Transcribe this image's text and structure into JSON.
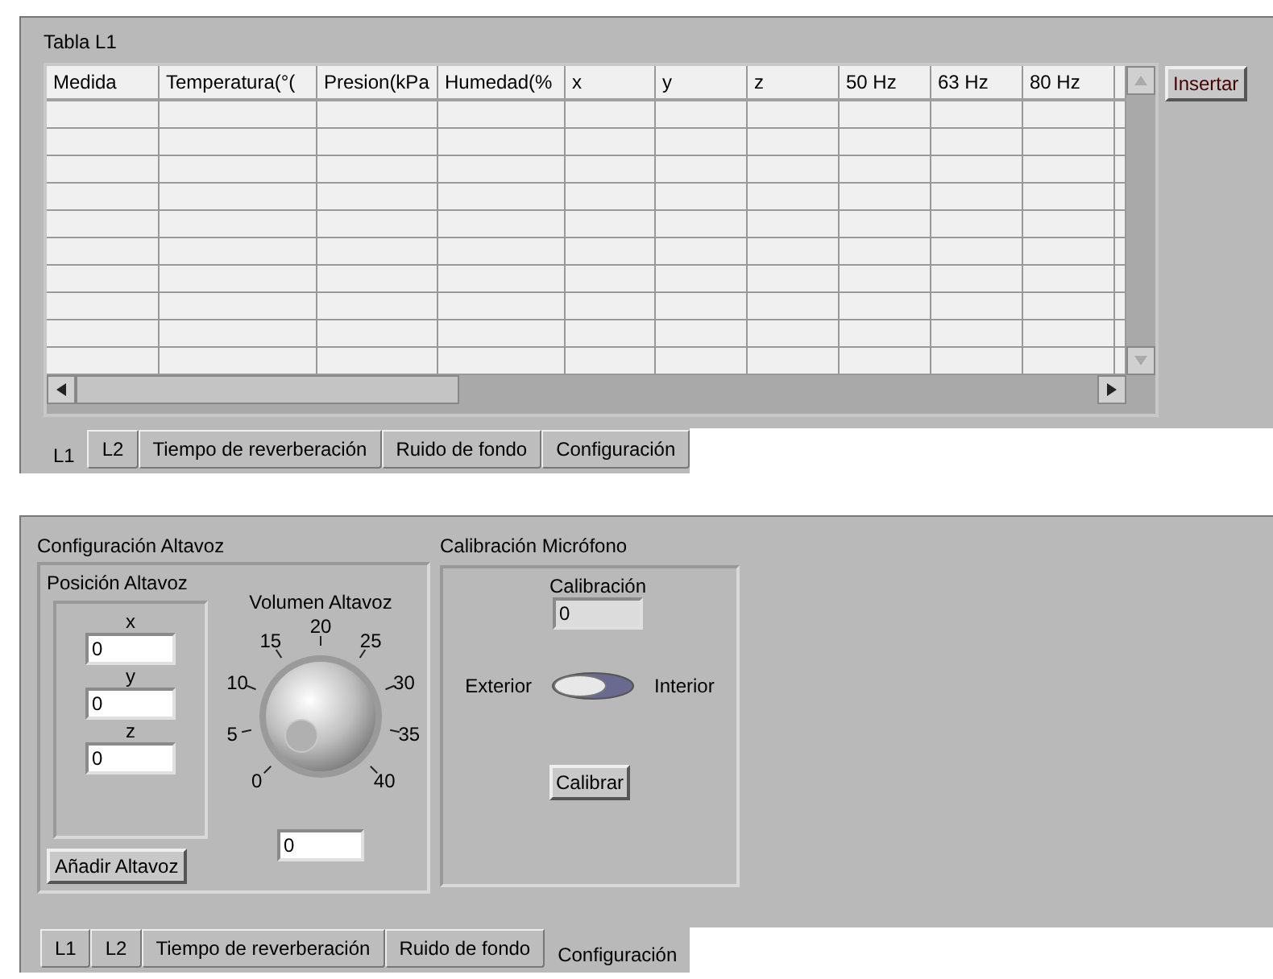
{
  "top_panel": {
    "table_label": "Tabla L1",
    "table": {
      "columns": [
        "Medida",
        "Temperatura(°(",
        "Presion(kPa",
        "Humedad(%",
        "x",
        "y",
        "z",
        "50 Hz",
        "63 Hz",
        "80 Hz"
      ]
    },
    "insert_button": "Insertar",
    "tabs": [
      {
        "label": "L1",
        "selected": true
      },
      {
        "label": "L2",
        "selected": false
      },
      {
        "label": "Tiempo de reverberación",
        "selected": false
      },
      {
        "label": "Ruido de fondo",
        "selected": false
      },
      {
        "label": "Configuración",
        "selected": false
      }
    ]
  },
  "bottom_panel": {
    "speaker_group": {
      "title": "Configuración Altavoz",
      "position": {
        "title": "Posición Altavoz",
        "fields": [
          {
            "label": "x",
            "value": "0"
          },
          {
            "label": "y",
            "value": "0"
          },
          {
            "label": "z",
            "value": "0"
          }
        ],
        "button": "Añadir Altavoz"
      },
      "volume": {
        "title": "Volumen Altavoz",
        "dial_labels": [
          "0",
          "5",
          "10",
          "15",
          "20",
          "25",
          "30",
          "35",
          "40"
        ],
        "value": "0"
      }
    },
    "calibration_group": {
      "title": "Calibración Micrófono",
      "field_label": "Calibración",
      "field_value": "0",
      "switch": {
        "left_label": "Exterior",
        "right_label": "Interior",
        "on": false
      },
      "button": "Calibrar"
    },
    "tabs": [
      {
        "label": "L1",
        "selected": false
      },
      {
        "label": "L2",
        "selected": false
      },
      {
        "label": "Tiempo de reverberación",
        "selected": false
      },
      {
        "label": "Ruido de fondo",
        "selected": false
      },
      {
        "label": "Configuración",
        "selected": true
      }
    ]
  }
}
